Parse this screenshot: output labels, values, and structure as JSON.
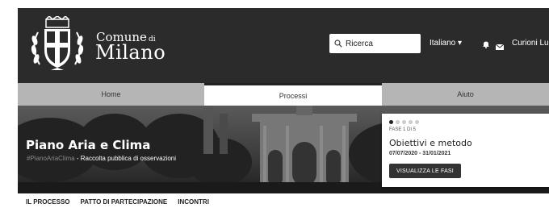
{
  "header": {
    "brand_line1": "Comune",
    "brand_di": "di",
    "brand_line2": "Milano",
    "logo_icon": "milano-coat-of-arms-icon",
    "search_placeholder": "Ricerca",
    "language": "Italiano",
    "user_name": "Curioni Luc"
  },
  "nav": [
    "Home",
    "Processi",
    "Aiuto"
  ],
  "hero": {
    "title": "Piano Aria e Clima",
    "hashtag": "#PianoAriaClima",
    "separator": "-",
    "subtitle": "Raccolta pubblica di osservazioni"
  },
  "phase_card": {
    "fase": "FASE 1 DI 5",
    "title": "Obiettivi e metodo",
    "dates": "07/07/2020 - 31/01/2021",
    "button": "VISUALIZZA LE FASI"
  },
  "subnav": [
    "IL PROCESSO",
    "PATTO DI PARTECIPAZIONE",
    "INCONTRI"
  ]
}
